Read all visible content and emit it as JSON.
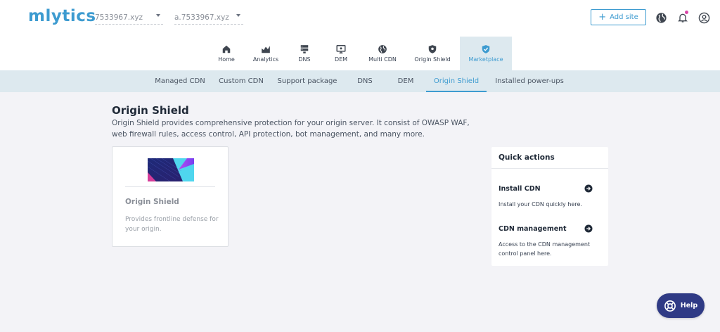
{
  "brand": {
    "logo_text": "mlytics",
    "accent": "#3d9bd0"
  },
  "header": {
    "domain_select_1": "7533967.xyz",
    "domain_select_2": "a.7533967.xyz",
    "add_site_label": "Add site",
    "icons": [
      "globe-icon",
      "bell-icon",
      "user-icon"
    ]
  },
  "main_nav": {
    "items": [
      {
        "label": "Home",
        "icon": "home-icon"
      },
      {
        "label": "Analytics",
        "icon": "analytics-icon"
      },
      {
        "label": "DNS",
        "icon": "server-icon"
      },
      {
        "label": "DEM",
        "icon": "monitor-icon"
      },
      {
        "label": "Multi CDN",
        "icon": "globe-icon"
      },
      {
        "label": "Origin Shield",
        "icon": "shield-icon"
      },
      {
        "label": "Marketplace",
        "icon": "shield-check-icon"
      }
    ],
    "active": "Marketplace"
  },
  "sub_nav": {
    "items": [
      "Managed CDN",
      "Custom CDN",
      "Support package",
      "DNS",
      "DEM",
      "Origin Shield",
      "Installed power-ups"
    ],
    "active": "Origin Shield"
  },
  "main": {
    "title": "Origin Shield",
    "description": "Origin Shield provides comprehensive protection for your origin server. It consist of OWASP WAF, web firewall rules, access control, API protection, bot management, and many more."
  },
  "card": {
    "title": "Origin Shield",
    "description": "Provides frontline defense for your origin."
  },
  "quick_actions": {
    "title": "Quick actions",
    "items": [
      {
        "title": "Install CDN",
        "description": "Install your CDN quickly here."
      },
      {
        "title": "CDN management",
        "description": "Access to the CDN management control panel here."
      }
    ]
  },
  "help": {
    "label": "Help",
    "bg_color": "#2f3a85"
  }
}
